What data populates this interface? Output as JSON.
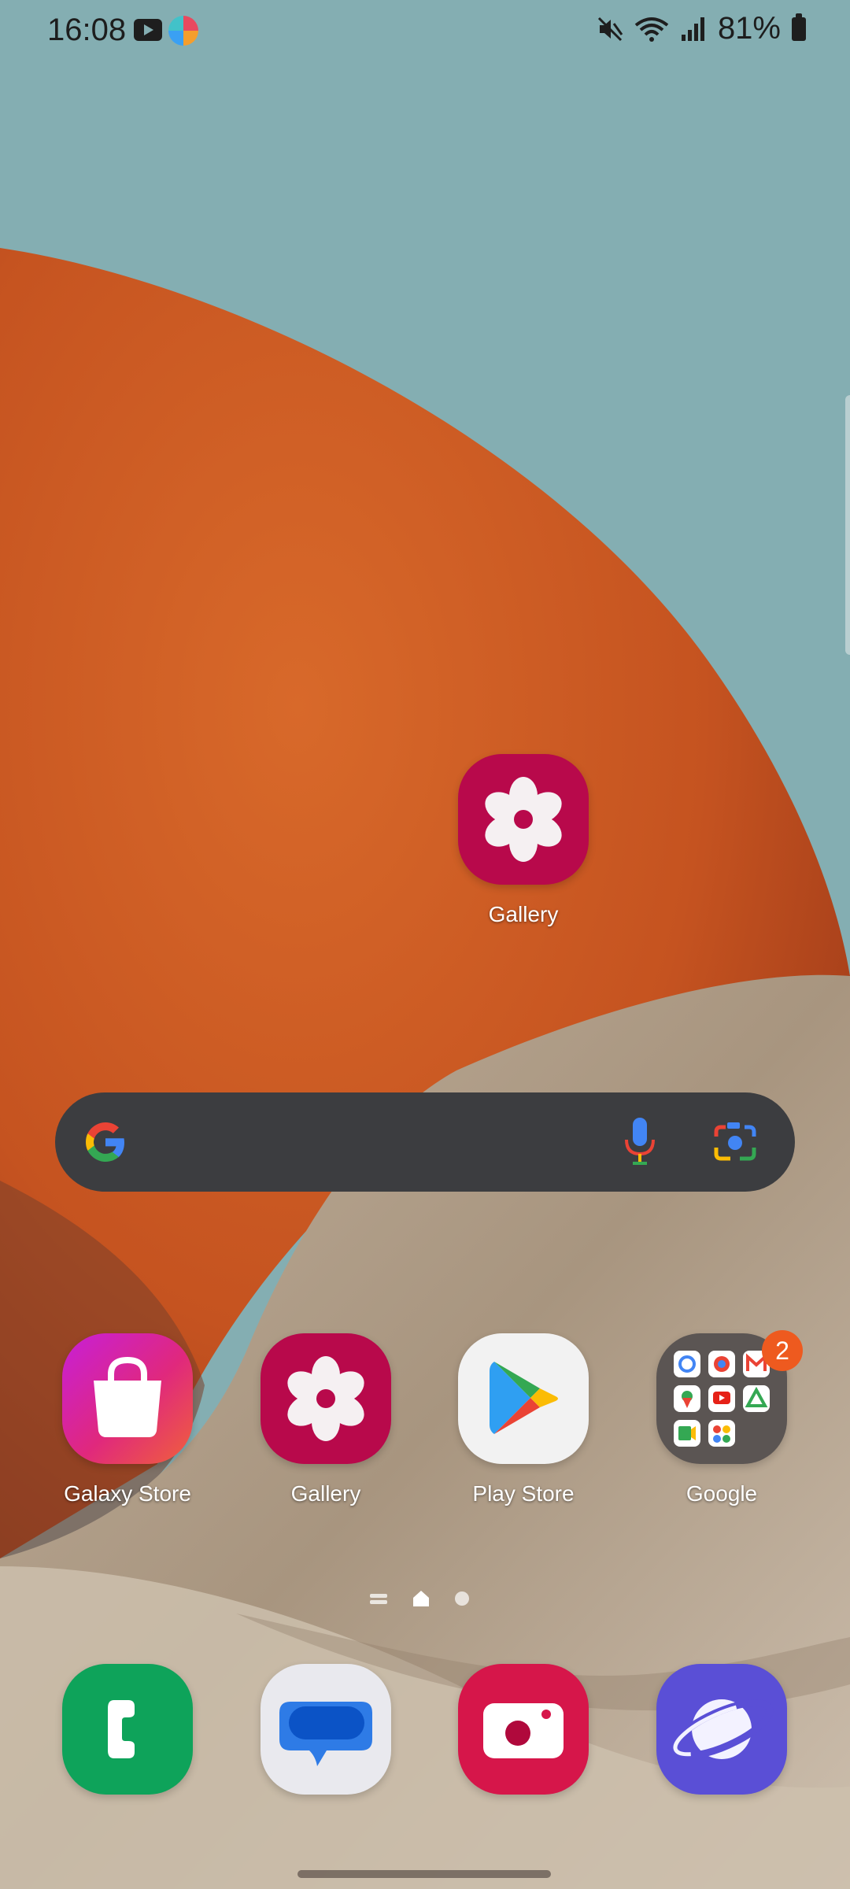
{
  "status_bar": {
    "time": "16:08",
    "notification_icons": [
      "youtube-icon",
      "app-notification-icon"
    ],
    "system_icons": [
      "mute-icon",
      "wifi-icon",
      "signal-icon",
      "battery-icon"
    ],
    "battery_percent": "81%"
  },
  "home": {
    "floating_app": {
      "label": "Gallery",
      "icon": "gallery-flower-icon"
    },
    "search_bar": {
      "icons": [
        "google-g-icon",
        "microphone-icon",
        "google-lens-icon"
      ]
    },
    "apps_row": [
      {
        "label": "Galaxy Store",
        "icon": "shopping-bag-icon"
      },
      {
        "label": "Gallery",
        "icon": "gallery-flower-icon"
      },
      {
        "label": "Play Store",
        "icon": "play-store-icon"
      },
      {
        "label": "Google",
        "icon": "folder-icon",
        "badge": "2"
      }
    ],
    "page_indicator": {
      "pages": [
        "menu",
        "home",
        "dot"
      ],
      "active": "home"
    }
  },
  "dock": [
    {
      "name": "Phone",
      "icon": "phone-icon"
    },
    {
      "name": "Messages",
      "icon": "messages-icon"
    },
    {
      "name": "Camera",
      "icon": "camera-icon"
    },
    {
      "name": "Internet",
      "icon": "internet-planet-icon"
    }
  ],
  "colors": {
    "sky": "#84aeb2",
    "orange": "#c9561e",
    "gallery": "#b8094b",
    "searchbar": "#3c3d40",
    "badge": "#ee5a1f"
  }
}
